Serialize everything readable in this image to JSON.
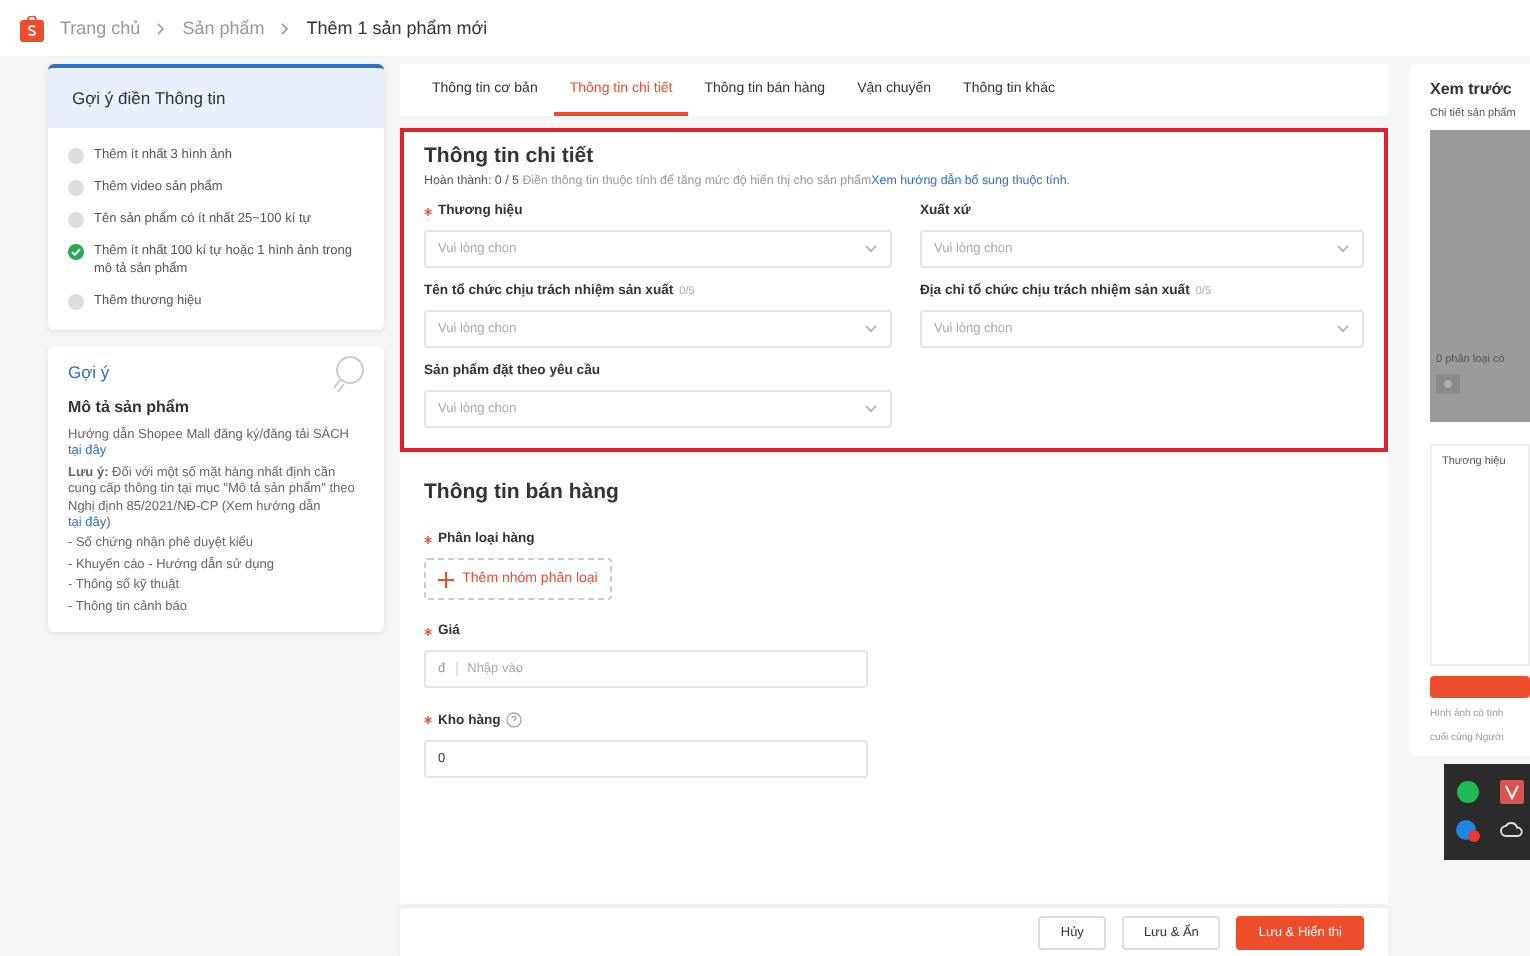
{
  "breadcrumb": [
    "Trang chủ",
    "Sản phẩm",
    "Thêm 1 sản phẩm mới"
  ],
  "checklist": {
    "title": "Gợi ý điền Thông tin",
    "items": [
      {
        "text": "Thêm ít nhất 3 hình ảnh",
        "done": false
      },
      {
        "text": "Thêm video sản phẩm",
        "done": false
      },
      {
        "text": "Tên sản phẩm có ít nhất 25~100 kí tự",
        "done": false
      },
      {
        "text": "Thêm ít nhất 100 kí tự hoặc 1 hình ảnh trong mô tả sản phẩm",
        "done": true
      },
      {
        "text": "Thêm thương hiệu",
        "done": false
      }
    ]
  },
  "tips": {
    "title": "Gợi ý",
    "subtitle": "Mô tả sản phẩm",
    "intro": "Hướng dẫn Shopee Mall đăng ký/đăng tải SÁCH",
    "intro_link": "tại đây",
    "note": "**Lưu ý:** Đối với một số mặt hàng nhất định cần cung cấp thông tin tại mục \"Mô tả sản phẩm\" theo Nghị định 85/2021/NĐ-CP (Xem hướng dẫn",
    "note_link": "tại đây",
    "note_end": ")",
    "bullets": [
      "- Số chứng nhận phê duyệt kiểu",
      "- Khuyến cáo - Hướng dẫn sử dụng",
      "- Thông số kỹ thuật",
      "- Thông tin cảnh báo"
    ]
  },
  "tabs": [
    {
      "label": "Thông tin cơ bản",
      "selected": false
    },
    {
      "label": "Thông tin chi tiết",
      "selected": true
    },
    {
      "label": "Thông tin bán hàng",
      "selected": false
    },
    {
      "label": "Vận chuyển",
      "selected": false
    },
    {
      "label": "Thông tin khác",
      "selected": false
    }
  ],
  "details": {
    "title": "Thông tin chi tiết",
    "progress_label": "Hoàn thành: 0 / 5",
    "hint": "Điền thông tin thuộc tính để tăng mức độ hiển thị cho sản phẩm",
    "hint_link": "Xem hướng dẫn bổ sung thuộc tính.",
    "fields": [
      {
        "label": "Thương hiệu",
        "required": true,
        "placeholder": "Vui lòng chọn"
      },
      {
        "label": "Xuất xứ",
        "required": false,
        "placeholder": "Vui lòng chọn"
      },
      {
        "label": "Tên tổ chức chịu trách nhiệm sản xuất",
        "required": false,
        "counter": "0/5",
        "placeholder": "Vui lòng chọn"
      },
      {
        "label": "Địa chỉ tổ chức chịu trách nhiệm sản xuất",
        "required": false,
        "counter": "0/5",
        "placeholder": "Vui lòng chọn"
      },
      {
        "label": "Sản phẩm đặt theo yêu cầu",
        "required": false,
        "placeholder": "Vui lòng chọn"
      }
    ]
  },
  "sales": {
    "title": "Thông tin bán hàng",
    "classification_label": "Phân loại hàng",
    "add_group": "Thêm nhóm phân loại",
    "price_label": "Giá",
    "currency": "đ",
    "price_placeholder": "Nhập vào",
    "stock_label": "Kho hàng",
    "stock_value": "0"
  },
  "footer_buttons": [
    {
      "label": "Hủy",
      "kind": "plain"
    },
    {
      "label": "Lưu & Ẩn",
      "kind": "plain"
    },
    {
      "label": "Lưu & Hiển thị",
      "kind": "primary"
    }
  ],
  "preview": {
    "title": "Xem trước",
    "subtitle": "Chi tiết sản phẩm",
    "variants": "0 phân loại có",
    "brand_label": "Thương hiệu",
    "note": [
      "Hình ảnh có tính",
      "cuối cùng Người"
    ]
  }
}
